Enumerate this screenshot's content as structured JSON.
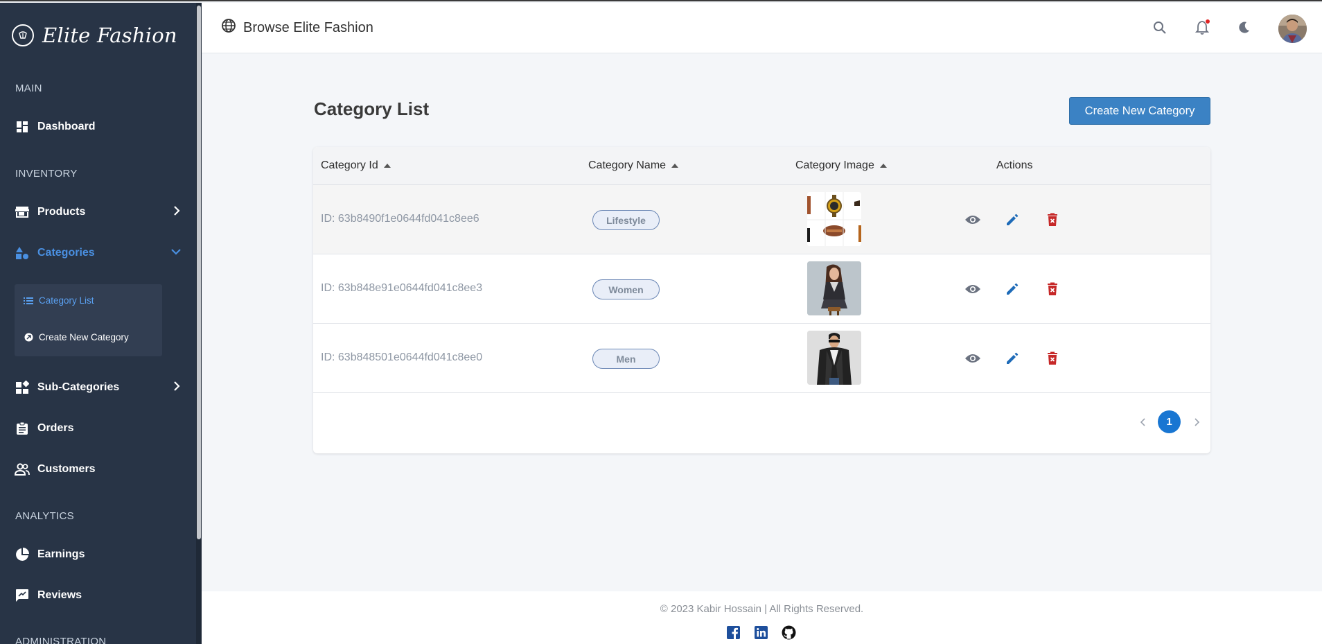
{
  "brand": {
    "name": "Elite Fashion"
  },
  "sidebar": {
    "sections": [
      "MAIN",
      "INVENTORY",
      "ANALYTICS",
      "ADMINISTRATION"
    ],
    "items": {
      "dashboard": "Dashboard",
      "products": "Products",
      "categories": "Categories",
      "sub_categories": "Sub-Categories",
      "orders": "Orders",
      "customers": "Customers",
      "earnings": "Earnings",
      "reviews": "Reviews"
    },
    "submenu": {
      "category_list": "Category List",
      "create_new_category": "Create New Category"
    },
    "accent": "#4a90e2",
    "background": "#283446"
  },
  "header": {
    "title": "Browse Elite Fashion",
    "icons": [
      "globe-icon",
      "search-icon",
      "bell-icon",
      "moon-icon",
      "avatar"
    ]
  },
  "main": {
    "title": "Category List",
    "create_button": "Create New Category",
    "table": {
      "columns": [
        "Category Id",
        "Category Name",
        "Category Image",
        "Actions"
      ],
      "rows": [
        {
          "id": "ID: 63b8490f1e0644fd041c8ee6",
          "name": "Lifestyle",
          "image": "lifestyle accessories collage"
        },
        {
          "id": "ID: 63b848e91e0644fd041c8ee3",
          "name": "Women",
          "image": "woman model"
        },
        {
          "id": "ID: 63b848501e0644fd041c8ee0",
          "name": "Men",
          "image": "man in leather jacket"
        }
      ],
      "actions": [
        "view-icon",
        "edit-icon",
        "delete-icon"
      ]
    },
    "pagination": {
      "current_page": "1"
    }
  },
  "footer": {
    "copyright": "© 2023 Kabir Hossain | All Rights Reserved.",
    "socials": [
      "facebook-icon",
      "linkedin-icon",
      "github-icon"
    ]
  },
  "colors": {
    "primary_button": "#3b82c4",
    "delete": "#c62828",
    "edit": "#1e6bb8",
    "page_active": "#1976d2"
  }
}
